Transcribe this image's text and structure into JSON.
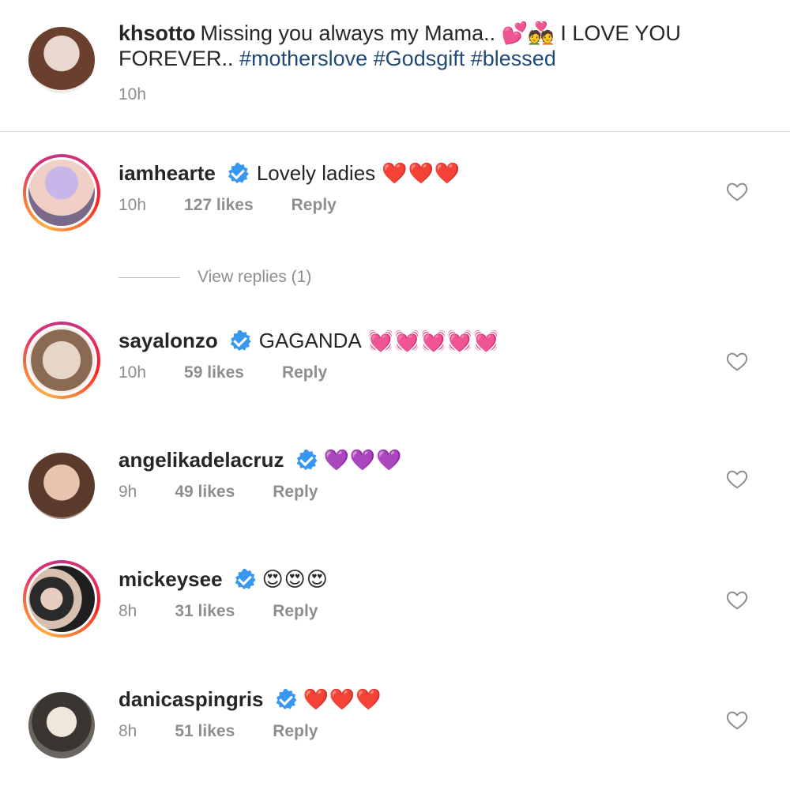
{
  "post": {
    "username": "khsotto",
    "caption_text": "Missing you always my Mama.. 💕💑 I LOVE YOU FOREVER..",
    "hashtags": [
      "#motherslove",
      "#Godsgift",
      "#blessed"
    ],
    "time": "10h"
  },
  "view_replies": "View replies (1)",
  "comments": [
    {
      "username": "iamhearte",
      "text": "Lovely ladies",
      "emoji": "❤️❤️❤️",
      "time": "10h",
      "likes": "127 likes",
      "reply": "Reply"
    },
    {
      "username": "sayalonzo",
      "text": "GAGANDA",
      "emoji": "💓💓💓💓💓",
      "time": "10h",
      "likes": "59 likes",
      "reply": "Reply"
    },
    {
      "username": "angelikadelacruz",
      "text": "",
      "emoji": "💜💜💜",
      "time": "9h",
      "likes": "49 likes",
      "reply": "Reply"
    },
    {
      "username": "mickeysee",
      "text": "",
      "emoji": "😍😍😍",
      "time": "8h",
      "likes": "31 likes",
      "reply": "Reply"
    },
    {
      "username": "danicaspingris",
      "text": "",
      "emoji": "❤️❤️❤️",
      "time": "8h",
      "likes": "51 likes",
      "reply": "Reply"
    }
  ],
  "colors": {
    "accent": "#3897f0",
    "hashtag": "#1f4a7a",
    "muted": "#8e8e8e"
  },
  "icons": {
    "verified": "verified-badge-icon",
    "like": "heart-outline-icon"
  }
}
